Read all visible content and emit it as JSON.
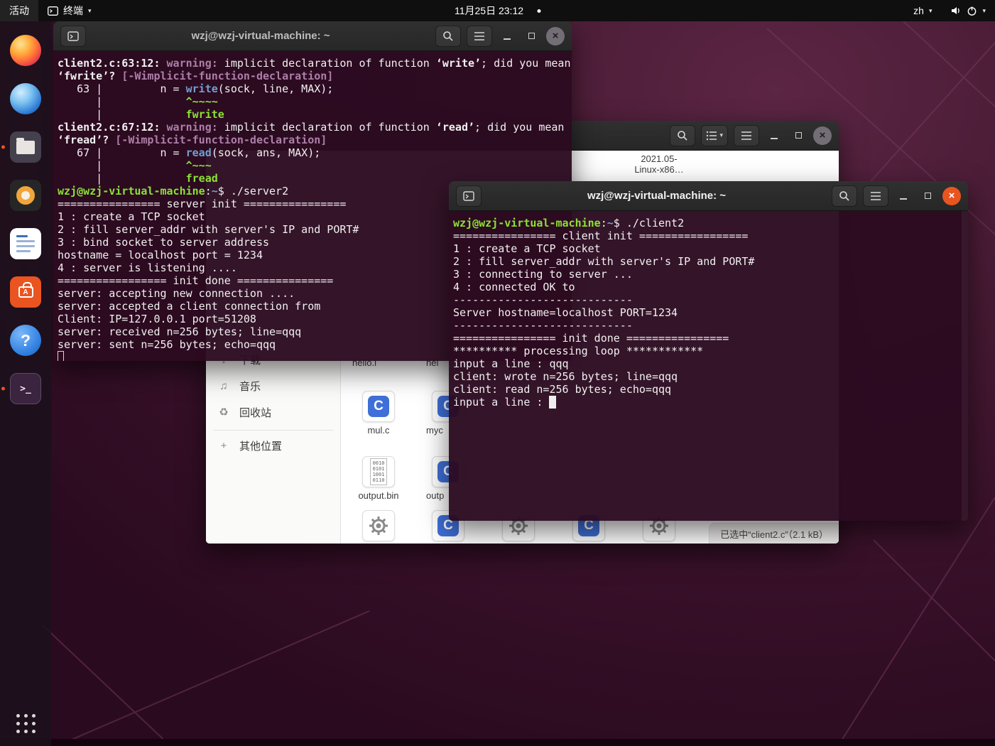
{
  "topbar": {
    "activities": "活动",
    "app_name": "终端",
    "clock": "11月25日 23:12",
    "keyboard": "zh"
  },
  "dock": {
    "items": [
      "firefox",
      "browser",
      "files",
      "media-player",
      "writer",
      "ubuntu-software",
      "help",
      "terminal"
    ]
  },
  "files_window": {
    "sidebar": {
      "items": [
        {
          "label": "下载"
        },
        {
          "label": "音乐"
        },
        {
          "label": "回收站"
        },
        {
          "label": "其他位置"
        }
      ]
    },
    "grid": {
      "far_file": {
        "line1": "2021.05-",
        "line2": "Linux-x86…"
      },
      "items": [
        {
          "label": "hello.l"
        },
        {
          "label": "hel"
        },
        {
          "label": "mul.c"
        },
        {
          "label": "myc"
        },
        {
          "label": "output.bin"
        },
        {
          "label": "outp"
        }
      ]
    },
    "statusbar": "已选中“client2.c”（2.1 kB）"
  },
  "terminal_server": {
    "title": "wzj@wzj-virtual-machine: ~",
    "lines": [
      [
        {
          "t": "client2.c:63:12:",
          "c": "bd"
        },
        {
          "t": " "
        },
        {
          "t": "warning:",
          "c": "mg bd"
        },
        {
          "t": " implicit declaration of function "
        },
        {
          "t": "‘write’",
          "c": "bd"
        },
        {
          "t": "; did you mean"
        }
      ],
      [
        {
          "t": "‘fwrite’? ",
          "c": "bd"
        },
        {
          "t": "[-Wimplicit-function-declaration]",
          "c": "mg bd"
        }
      ],
      [
        {
          "t": "   63 |         n = "
        },
        {
          "t": "write",
          "c": "bl bd"
        },
        {
          "t": "(sock, line, MAX);"
        }
      ],
      [
        {
          "t": "      |             "
        },
        {
          "t": "^~~~~",
          "c": "gr bd"
        }
      ],
      [
        {
          "t": "      |             "
        },
        {
          "t": "fwrite",
          "c": "gr bd"
        }
      ],
      [
        {
          "t": "client2.c:67:12:",
          "c": "bd"
        },
        {
          "t": " "
        },
        {
          "t": "warning:",
          "c": "mg bd"
        },
        {
          "t": " implicit declaration of function "
        },
        {
          "t": "‘read’",
          "c": "bd"
        },
        {
          "t": "; did you mean"
        }
      ],
      [
        {
          "t": "‘fread’? ",
          "c": "bd"
        },
        {
          "t": "[-Wimplicit-function-declaration]",
          "c": "mg bd"
        }
      ],
      [
        {
          "t": "   67 |         n = "
        },
        {
          "t": "read",
          "c": "bl bd"
        },
        {
          "t": "(sock, ans, MAX);"
        }
      ],
      [
        {
          "t": "      |             "
        },
        {
          "t": "^~~~",
          "c": "gr bd"
        }
      ],
      [
        {
          "t": "      |             "
        },
        {
          "t": "fread",
          "c": "gr bd"
        }
      ],
      [
        {
          "t": "wzj@wzj-virtual-machine",
          "c": "gr bd"
        },
        {
          "t": ":"
        },
        {
          "t": "~",
          "c": "bl bd"
        },
        {
          "t": "$ ./server2"
        }
      ],
      [
        {
          "t": "================ server init ================"
        }
      ],
      [
        {
          "t": "1 : create a TCP socket"
        }
      ],
      [
        {
          "t": "2 : fill server_addr with server's IP and PORT#"
        }
      ],
      [
        {
          "t": "3 : bind socket to server address"
        }
      ],
      [
        {
          "t": "hostname = localhost port = 1234"
        }
      ],
      [
        {
          "t": "4 : server is listening ...."
        }
      ],
      [
        {
          "t": "================= init done ==============="
        }
      ],
      [
        {
          "t": "server: accepting new connection ...."
        }
      ],
      [
        {
          "t": "server: accepted a client connection from"
        }
      ],
      [
        {
          "t": "Client: IP=127.0.0.1 port=51208"
        }
      ],
      [
        {
          "t": "server: received n=256 bytes; line=qqq"
        }
      ],
      [
        {
          "t": "server: sent n=256 bytes; echo=qqq"
        }
      ],
      [
        {
          "t": " ",
          "c": "cur-hollow"
        }
      ]
    ]
  },
  "terminal_client": {
    "title": "wzj@wzj-virtual-machine: ~",
    "lines": [
      [
        {
          "t": "wzj@wzj-virtual-machine",
          "c": "gr bd"
        },
        {
          "t": ":"
        },
        {
          "t": "~",
          "c": "bl bd"
        },
        {
          "t": "$ ./client2"
        }
      ],
      [
        {
          "t": "================ client init ================="
        }
      ],
      [
        {
          "t": "1 : create a TCP socket"
        }
      ],
      [
        {
          "t": "2 : fill server_addr with server's IP and PORT#"
        }
      ],
      [
        {
          "t": "3 : connecting to server ..."
        }
      ],
      [
        {
          "t": "4 : connected OK to"
        }
      ],
      [
        {
          "t": "----------------------------"
        }
      ],
      [
        {
          "t": "Server hostname=localhost PORT=1234"
        }
      ],
      [
        {
          "t": "----------------------------"
        }
      ],
      [
        {
          "t": "================ init done ================"
        }
      ],
      [
        {
          "t": "********** processing loop ************"
        }
      ],
      [
        {
          "t": "input a line : qqq"
        }
      ],
      [
        {
          "t": "client: wrote n=256 bytes; line=qqq"
        }
      ],
      [
        {
          "t": "client: read n=256 bytes; echo=qqq"
        }
      ],
      [
        {
          "t": "input a line : "
        },
        {
          "t": " ",
          "c": "cur-solid"
        }
      ]
    ]
  }
}
